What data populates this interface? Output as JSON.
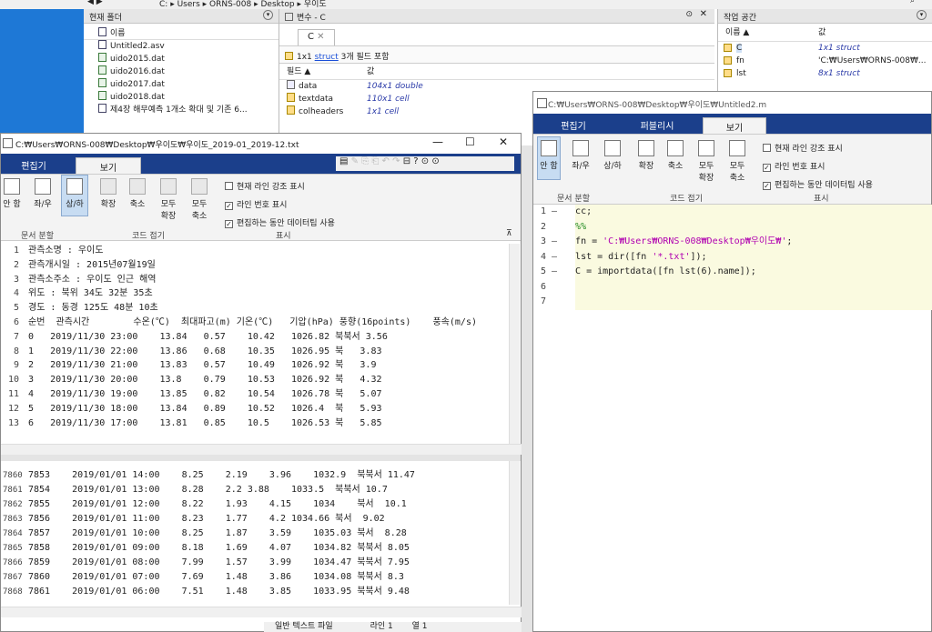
{
  "address_bar": {
    "path": [
      "C:",
      "Users",
      "ORNS-008",
      "Desktop",
      "우이도"
    ]
  },
  "file_browser": {
    "title": "현재 폴더",
    "column": "이름",
    "files": [
      {
        "name": "Untitled2.asv",
        "type": "asv"
      },
      {
        "name": "uido2015.dat",
        "type": "dat"
      },
      {
        "name": "uido2016.dat",
        "type": "dat"
      },
      {
        "name": "uido2017.dat",
        "type": "dat"
      },
      {
        "name": "uido2018.dat",
        "type": "dat"
      },
      {
        "name": "제4장 해무예측 1개소 확대 및 기존 6...",
        "type": "asv"
      }
    ]
  },
  "variable_editor": {
    "title": "변수 - C",
    "tab": "C",
    "info_prefix": "1x1",
    "info_link": "struct",
    "info_suffix": "3개 필드 포함",
    "col_field": "필드 ▲",
    "col_value": "값",
    "fields": [
      {
        "name": "data",
        "value": "104x1 double"
      },
      {
        "name": "textdata",
        "value": "110x1 cell"
      },
      {
        "name": "colheaders",
        "value": "1x1 cell"
      }
    ]
  },
  "workspace": {
    "title": "작업 공간",
    "col_name": "이름 ▲",
    "col_value": "값",
    "vars": [
      {
        "name": "C",
        "value": "1x1 struct"
      },
      {
        "name": "fn",
        "value": "'C:₩Users₩ORNS-008₩..."
      },
      {
        "name": "lst",
        "value": "8x1 struct"
      }
    ]
  },
  "text_window": {
    "title": "C:₩Users₩ORNS-008₩Desktop₩우이도₩우이도_2019-01_2019-12.txt",
    "tabs": [
      "편집기",
      "보기"
    ],
    "ribbon": {
      "layout_buttons": [
        "안 함",
        "좌/우",
        "상/하"
      ],
      "fold_buttons": [
        "확장",
        "축소",
        "모두\n확장",
        "모두\n축소"
      ],
      "checks": [
        "현재 라인 강조 표시",
        "라인 번호 표시",
        "편집하는 동안 데이터팁 사용"
      ],
      "groups": [
        "문서 분할",
        "코드 접기",
        "표시"
      ]
    },
    "top_lines": [
      {
        "n": "1",
        "t": "관측소명 : 우이도"
      },
      {
        "n": "2",
        "t": "관측개시일 : 2015년07월19일"
      },
      {
        "n": "3",
        "t": "관측소주소 : 우이도 인근 해역"
      },
      {
        "n": "4",
        "t": "위도 : 북위 34도 32분 35초"
      },
      {
        "n": "5",
        "t": "경도 : 동경 125도 48분 10초"
      },
      {
        "n": "6",
        "t": "순번  관측시간        수온(℃)  최대파고(m) 기온(℃)   기압(hPa) 풍향(16points)    풍속(m/s)"
      },
      {
        "n": "7",
        "t": "0   2019/11/30 23:00    13.84   0.57    10.42   1026.82 북북서 3.56"
      },
      {
        "n": "8",
        "t": "1   2019/11/30 22:00    13.86   0.68    10.35   1026.95 북   3.83"
      },
      {
        "n": "9",
        "t": "2   2019/11/30 21:00    13.83   0.57    10.49   1026.92 북   3.9"
      },
      {
        "n": "10",
        "t": "3   2019/11/30 20:00    13.8    0.79    10.53   1026.92 북   4.32"
      },
      {
        "n": "11",
        "t": "4   2019/11/30 19:00    13.85   0.82    10.54   1026.78 북   5.07"
      },
      {
        "n": "12",
        "t": "5   2019/11/30 18:00    13.84   0.89    10.52   1026.4  북   5.93"
      },
      {
        "n": "13",
        "t": "6   2019/11/30 17:00    13.81   0.85    10.5    1026.53 북   5.85"
      }
    ],
    "bottom_lines": [
      {
        "n": "7860",
        "t": "7853    2019/01/01 14:00    8.25    2.19    3.96    1032.9  북북서 11.47"
      },
      {
        "n": "7861",
        "t": "7854    2019/01/01 13:00    8.28    2.2 3.88    1033.5  북북서 10.7"
      },
      {
        "n": "7862",
        "t": "7855    2019/01/01 12:00    8.22    1.93    4.15    1034    북서  10.1"
      },
      {
        "n": "7863",
        "t": "7856    2019/01/01 11:00    8.23    1.77    4.2 1034.66 북서  9.02"
      },
      {
        "n": "7864",
        "t": "7857    2019/01/01 10:00    8.25    1.87    3.59    1035.03 북서  8.28"
      },
      {
        "n": "7865",
        "t": "7858    2019/01/01 09:00    8.18    1.69    4.07    1034.82 북북서 8.05"
      },
      {
        "n": "7866",
        "t": "7859    2019/01/01 08:00    7.99    1.57    3.99    1034.47 북북서 7.95"
      },
      {
        "n": "7867",
        "t": "7860    2019/01/01 07:00    7.69    1.48    3.86    1034.08 북북서 8.3"
      },
      {
        "n": "7868",
        "t": "7861    2019/01/01 06:00    7.51    1.48    3.85    1033.95 북북서 9.48"
      }
    ],
    "status": {
      "type": "일반 텍스트 파일",
      "line_label": "라인",
      "line": "1",
      "col_label": "열",
      "col": "1"
    }
  },
  "editor_window": {
    "title": "C:₩Users₩ORNS-008₩Desktop₩우이도₩Untitled2.m",
    "tabs": [
      "편집기",
      "퍼블리시",
      "보기"
    ],
    "ribbon": {
      "layout_buttons": [
        "안 함",
        "좌/우",
        "상/하"
      ],
      "fold_buttons": [
        "확장",
        "축소",
        "모두\n확장",
        "모두\n축소"
      ],
      "checks": [
        "현재 라인 강조 표시",
        "라인 번호 표시",
        "편집하는 동안 데이터팁 사용"
      ],
      "groups": [
        "문서 분할",
        "코드 접기",
        "표시"
      ]
    },
    "lines": [
      {
        "n": "1 –",
        "plain": "cc;",
        "str": "",
        "tail": ""
      },
      {
        "n": "2",
        "plain": "",
        "cmt": "%%",
        "str": "",
        "tail": ""
      },
      {
        "n": "3 –",
        "plain": "fn = ",
        "str": "'C:₩Users₩ORNS-008₩Desktop₩우이도₩'",
        "tail": ";"
      },
      {
        "n": "4 –",
        "plain": "lst = dir([fn ",
        "str": "'*.txt'",
        "tail": "]);"
      },
      {
        "n": "5 –",
        "plain": "C = importdata([fn lst(6).name]);",
        "str": "",
        "tail": ""
      },
      {
        "n": "6",
        "plain": "",
        "str": "",
        "tail": ""
      },
      {
        "n": "7",
        "plain": "",
        "str": "",
        "tail": ""
      }
    ]
  },
  "colors": {
    "desktop": "#1e78d6",
    "editor_tabbar": "#1b3f8b",
    "code_bg": "#fafae0",
    "string": "#b000b0",
    "comment": "#228b22"
  }
}
